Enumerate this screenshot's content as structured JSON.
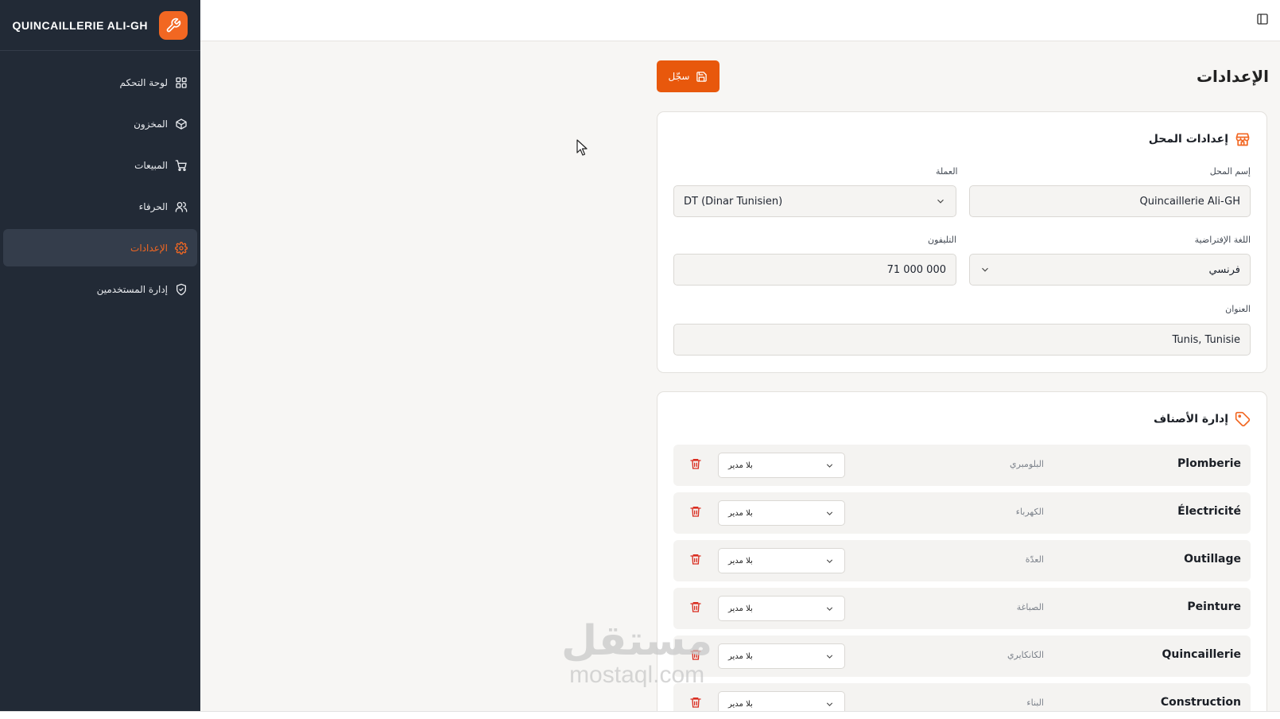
{
  "app": {
    "brand": "QUINCAILLERIE ALI-GH",
    "accent": "#f26722",
    "sidebar_bg": "#222a36"
  },
  "nav": [
    {
      "label": "لوحة التحكم",
      "icon": "dashboard-icon",
      "active": false
    },
    {
      "label": "المخزون",
      "icon": "package-icon",
      "active": false
    },
    {
      "label": "المبيعات",
      "icon": "cart-icon",
      "active": false
    },
    {
      "label": "الحرفاء",
      "icon": "users-icon",
      "active": false
    },
    {
      "label": "الإعدادات",
      "icon": "gear-icon",
      "active": true
    },
    {
      "label": "إدارة المستخدمين",
      "icon": "shield-icon",
      "active": false
    }
  ],
  "page": {
    "title": "الإعدادات",
    "save_label": "سجّل"
  },
  "shop": {
    "title": "إعدادات المحل",
    "name_label": "إسم المحل",
    "name_value": "Quincaillerie Ali-GH",
    "currency_label": "العملة",
    "currency_value": "DT (Dinar Tunisien)",
    "language_label": "اللغة الإفتراضية",
    "language_value": "فرنسي",
    "phone_label": "التليفون",
    "phone_value": "71 000 000",
    "address_label": "العنوان",
    "address_value": "Tunis, Tunisie"
  },
  "categories": {
    "title": "إدارة الأصناف",
    "rows": [
      {
        "name": "Plomberie",
        "ar": "البلومبري",
        "manager": "بلا مدير"
      },
      {
        "name": "Électricité",
        "ar": "الكهرباء",
        "manager": "بلا مدير"
      },
      {
        "name": "Outillage",
        "ar": "العدّة",
        "manager": "بلا مدير"
      },
      {
        "name": "Peinture",
        "ar": "الصباغة",
        "manager": "بلا مدير"
      },
      {
        "name": "Quincaillerie",
        "ar": "الكانكايري",
        "manager": "بلا مدير"
      },
      {
        "name": "Construction",
        "ar": "البناء",
        "manager": "بلا مدير"
      }
    ]
  },
  "watermark": {
    "arabic": "مستقل",
    "latin": "mostaql.com"
  }
}
